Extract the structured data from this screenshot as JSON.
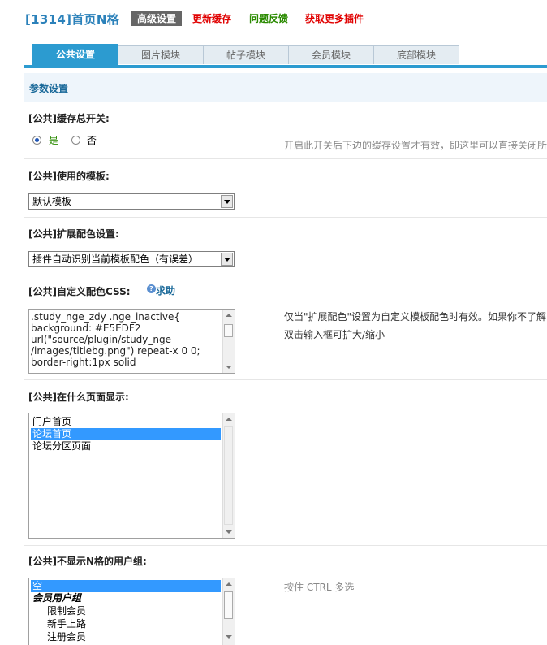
{
  "header": {
    "title": "[1314]首页N格",
    "buttons": [
      {
        "label": "高级设置"
      },
      {
        "label": "更新缓存"
      },
      {
        "label": "问题反馈"
      },
      {
        "label": "获取更多插件"
      }
    ]
  },
  "tabs": [
    {
      "label": "公共设置",
      "active": true
    },
    {
      "label": "图片模块",
      "active": false
    },
    {
      "label": "帖子模块",
      "active": false
    },
    {
      "label": "会员模块",
      "active": false
    },
    {
      "label": "底部模块",
      "active": false
    }
  ],
  "section_title": "参数设置",
  "settings": {
    "cache": {
      "label": "[公共]缓存总开关:",
      "options": [
        "是",
        "否"
      ],
      "selected": "是",
      "hint": "开启此开关后下边的缓存设置才有效，即这里可以直接关闭所"
    },
    "template": {
      "label": "[公共]使用的模板:",
      "value": "默认模板"
    },
    "color_ext": {
      "label": "[公共]扩展配色设置:",
      "value": "插件自动识别当前模板配色（有误差）"
    },
    "custom_css": {
      "label": "[公共]自定义配色CSS:",
      "help_label": "求助",
      "value": ".study_nge_zdy .nge_inactive{\nbackground: #E5EDF2\nurl(\"source/plugin/study_nge\n/images/titlebg.png\") repeat-x 0 0;\nborder-right:1px solid",
      "hint_line1": "仅当\"扩展配色\"设置为自定义模板配色时有效。如果你不了解",
      "hint_line2": "双击输入框可扩大/缩小"
    },
    "pages": {
      "label": "[公共]在什么页面显示:",
      "options": [
        "门户首页",
        "论坛首页",
        "论坛分区页面"
      ],
      "selected": "论坛首页"
    },
    "hidden_groups": {
      "label": "[公共]不显示N格的用户组:",
      "options": [
        {
          "label": "空",
          "selected": true,
          "type": "option"
        },
        {
          "label": "会员用户组",
          "selected": false,
          "type": "group"
        },
        {
          "label": "限制会员",
          "selected": false,
          "type": "indent"
        },
        {
          "label": "新手上路",
          "selected": false,
          "type": "indent"
        },
        {
          "label": "注册会员",
          "selected": false,
          "type": "indent"
        }
      ],
      "hint": "按住 CTRL 多选"
    }
  },
  "colors": {
    "accent": "#2c9bd0",
    "title": "#2b81ba",
    "red_link": "#e00000",
    "green_link": "#2a8a00",
    "selection": "#3399ff"
  }
}
